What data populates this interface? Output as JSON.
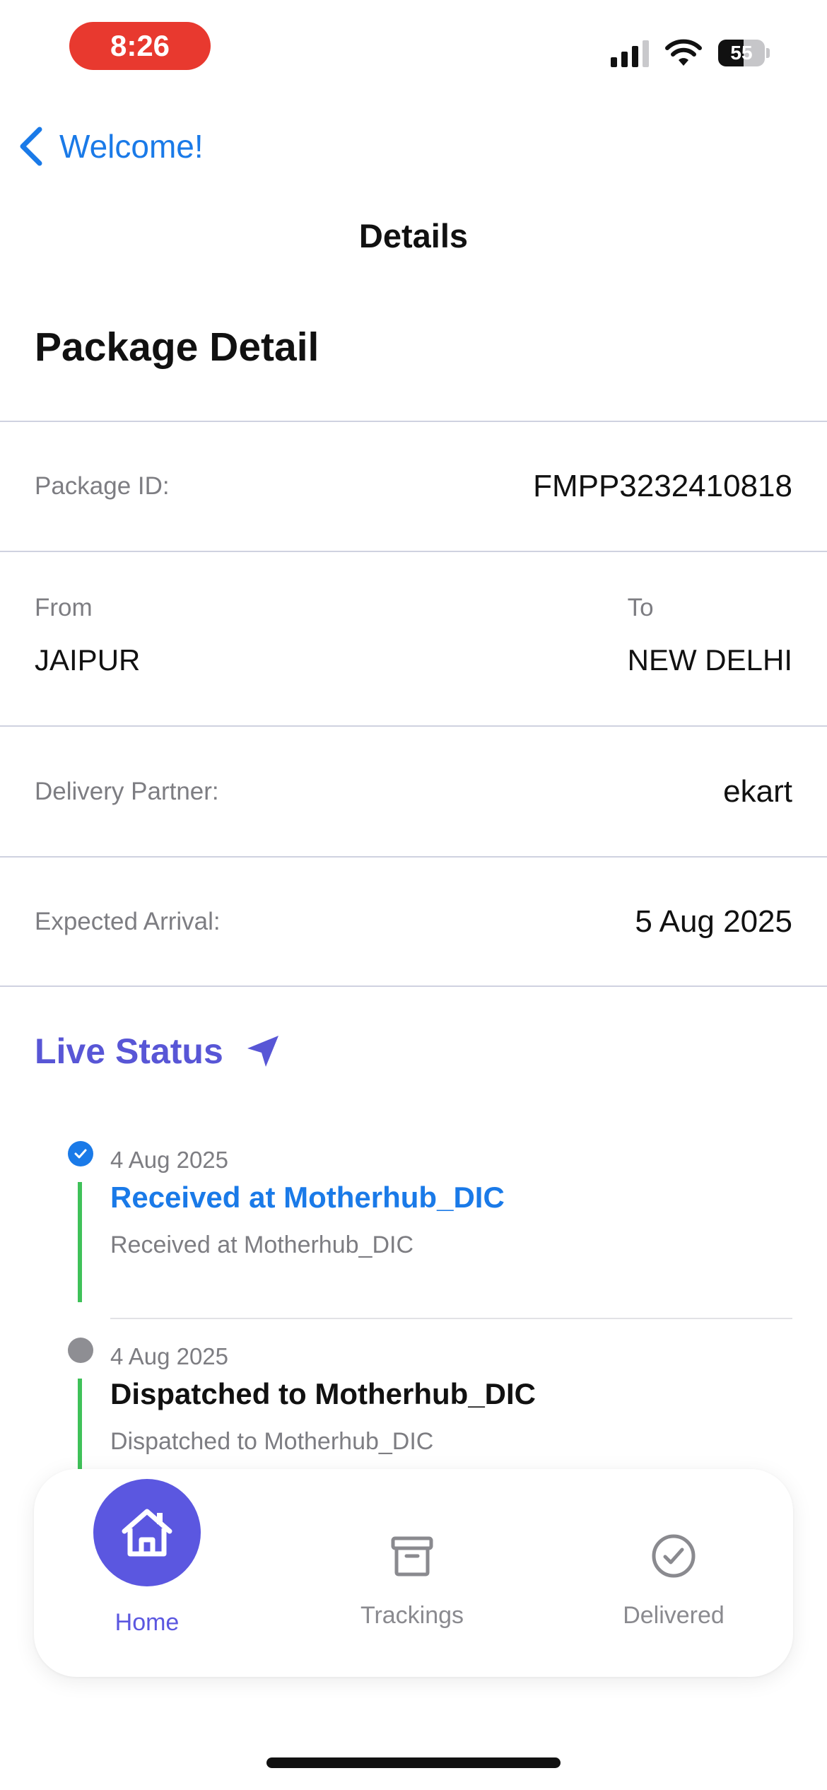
{
  "status_bar": {
    "time": "8:26",
    "battery_level": "55",
    "battery_fraction": 0.55
  },
  "nav": {
    "back_label": "Welcome!",
    "title": "Details"
  },
  "section_title": "Package Detail",
  "package": {
    "id_label": "Package ID:",
    "id_value": "FMPP3232410818",
    "from_label": "From",
    "from_value": "JAIPUR",
    "to_label": "To",
    "to_value": "NEW DELHI",
    "partner_label": "Delivery Partner:",
    "partner_value": "ekart",
    "arrival_label": "Expected Arrival:",
    "arrival_value": "5 Aug 2025"
  },
  "live_status": {
    "label": "Live Status",
    "icon": "navigation-arrow-icon",
    "events": [
      {
        "date": "4 Aug 2025",
        "title": "Received at Motherhub_DIC",
        "description": "Received at Motherhub_DIC",
        "state": "done"
      },
      {
        "date": "4 Aug 2025",
        "title": "Dispatched to Motherhub_DIC",
        "description": "Dispatched to Motherhub_DIC",
        "state": "pending"
      }
    ]
  },
  "tabs": [
    {
      "label": "Home",
      "icon": "house-icon",
      "active": true
    },
    {
      "label": "Trackings",
      "icon": "archive-box-icon",
      "active": false
    },
    {
      "label": "Delivered",
      "icon": "checkmark-circle-icon",
      "active": false
    }
  ],
  "colors": {
    "accent_blue": "#1a7ae8",
    "accent_purple": "#5b57e0",
    "timeline_green": "#3fc159",
    "time_pill_red": "#e8392f"
  }
}
